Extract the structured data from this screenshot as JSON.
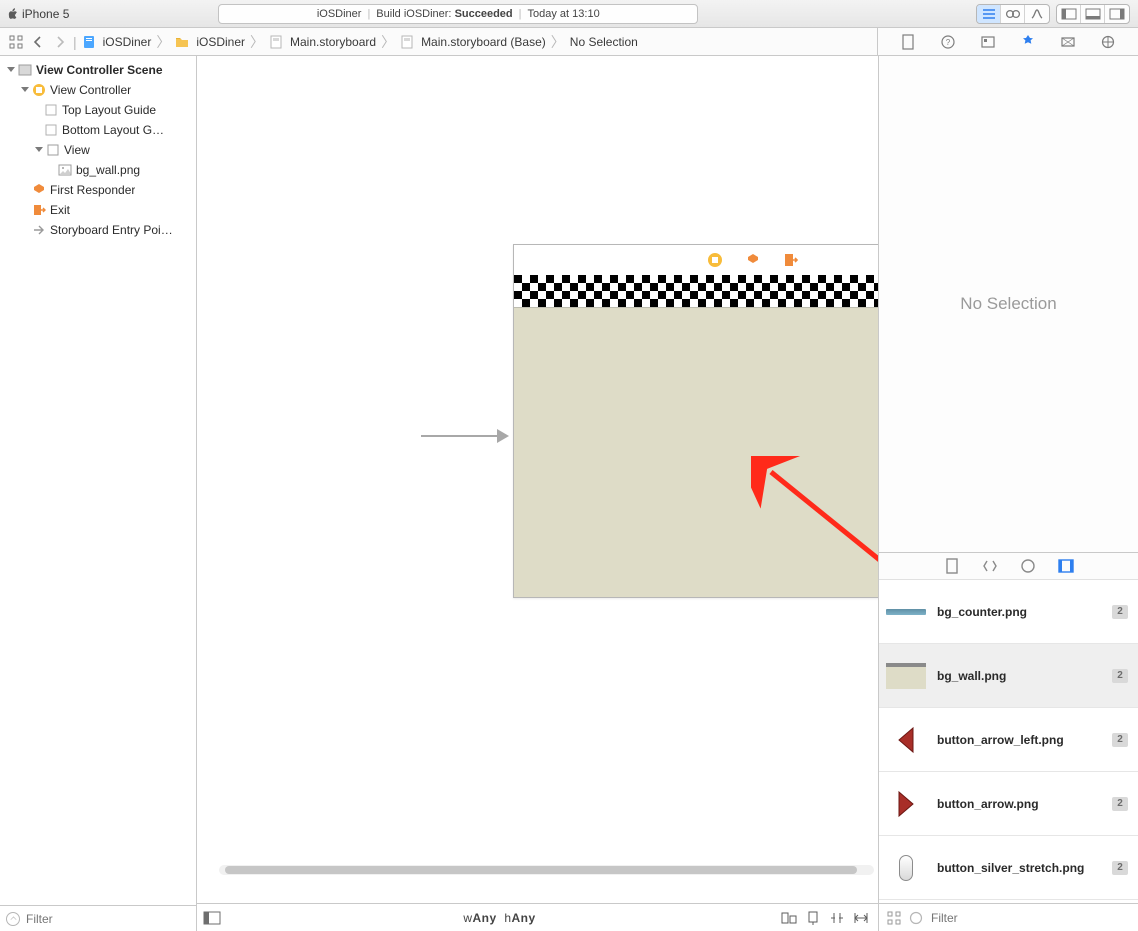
{
  "toolbar": {
    "scheme_device": "iPhone 5",
    "status_project": "iOSDiner",
    "status_action_prefix": "Build iOSDiner:",
    "status_result": "Succeeded",
    "status_time": "Today at 13:10"
  },
  "jumpbar": {
    "items": [
      {
        "icon": "doc-blue",
        "label": "iOSDiner"
      },
      {
        "icon": "folder-yellow",
        "label": "iOSDiner"
      },
      {
        "icon": "doc-gray",
        "label": "Main.storyboard"
      },
      {
        "icon": "doc-gray",
        "label": "Main.storyboard (Base)"
      },
      {
        "icon": "",
        "label": "No Selection"
      }
    ]
  },
  "navigator": {
    "tree": {
      "scene": "View Controller Scene",
      "vc": "View Controller",
      "top_guide": "Top Layout Guide",
      "bottom_guide": "Bottom Layout G…",
      "view": "View",
      "image": "bg_wall.png",
      "first_responder": "First Responder",
      "exit": "Exit",
      "entry_point": "Storyboard Entry Poi…"
    },
    "filter_placeholder": "Filter"
  },
  "canvas": {
    "size_label_w": "Any",
    "size_label_h": "Any",
    "size_prefix_w": "w",
    "size_prefix_h": "h"
  },
  "inspector": {
    "empty_text": "No Selection"
  },
  "library": {
    "items": [
      {
        "name": "bg_counter.png",
        "badge": "2",
        "thumb": "counter"
      },
      {
        "name": "bg_wall.png",
        "badge": "2",
        "thumb": "wall",
        "selected": true
      },
      {
        "name": "button_arrow_left.png",
        "badge": "2",
        "thumb": "arrow-left"
      },
      {
        "name": "button_arrow.png",
        "badge": "2",
        "thumb": "arrow-right"
      },
      {
        "name": "button_silver_stretch.png",
        "badge": "2",
        "thumb": "pill"
      }
    ],
    "filter_placeholder": "Filter"
  }
}
